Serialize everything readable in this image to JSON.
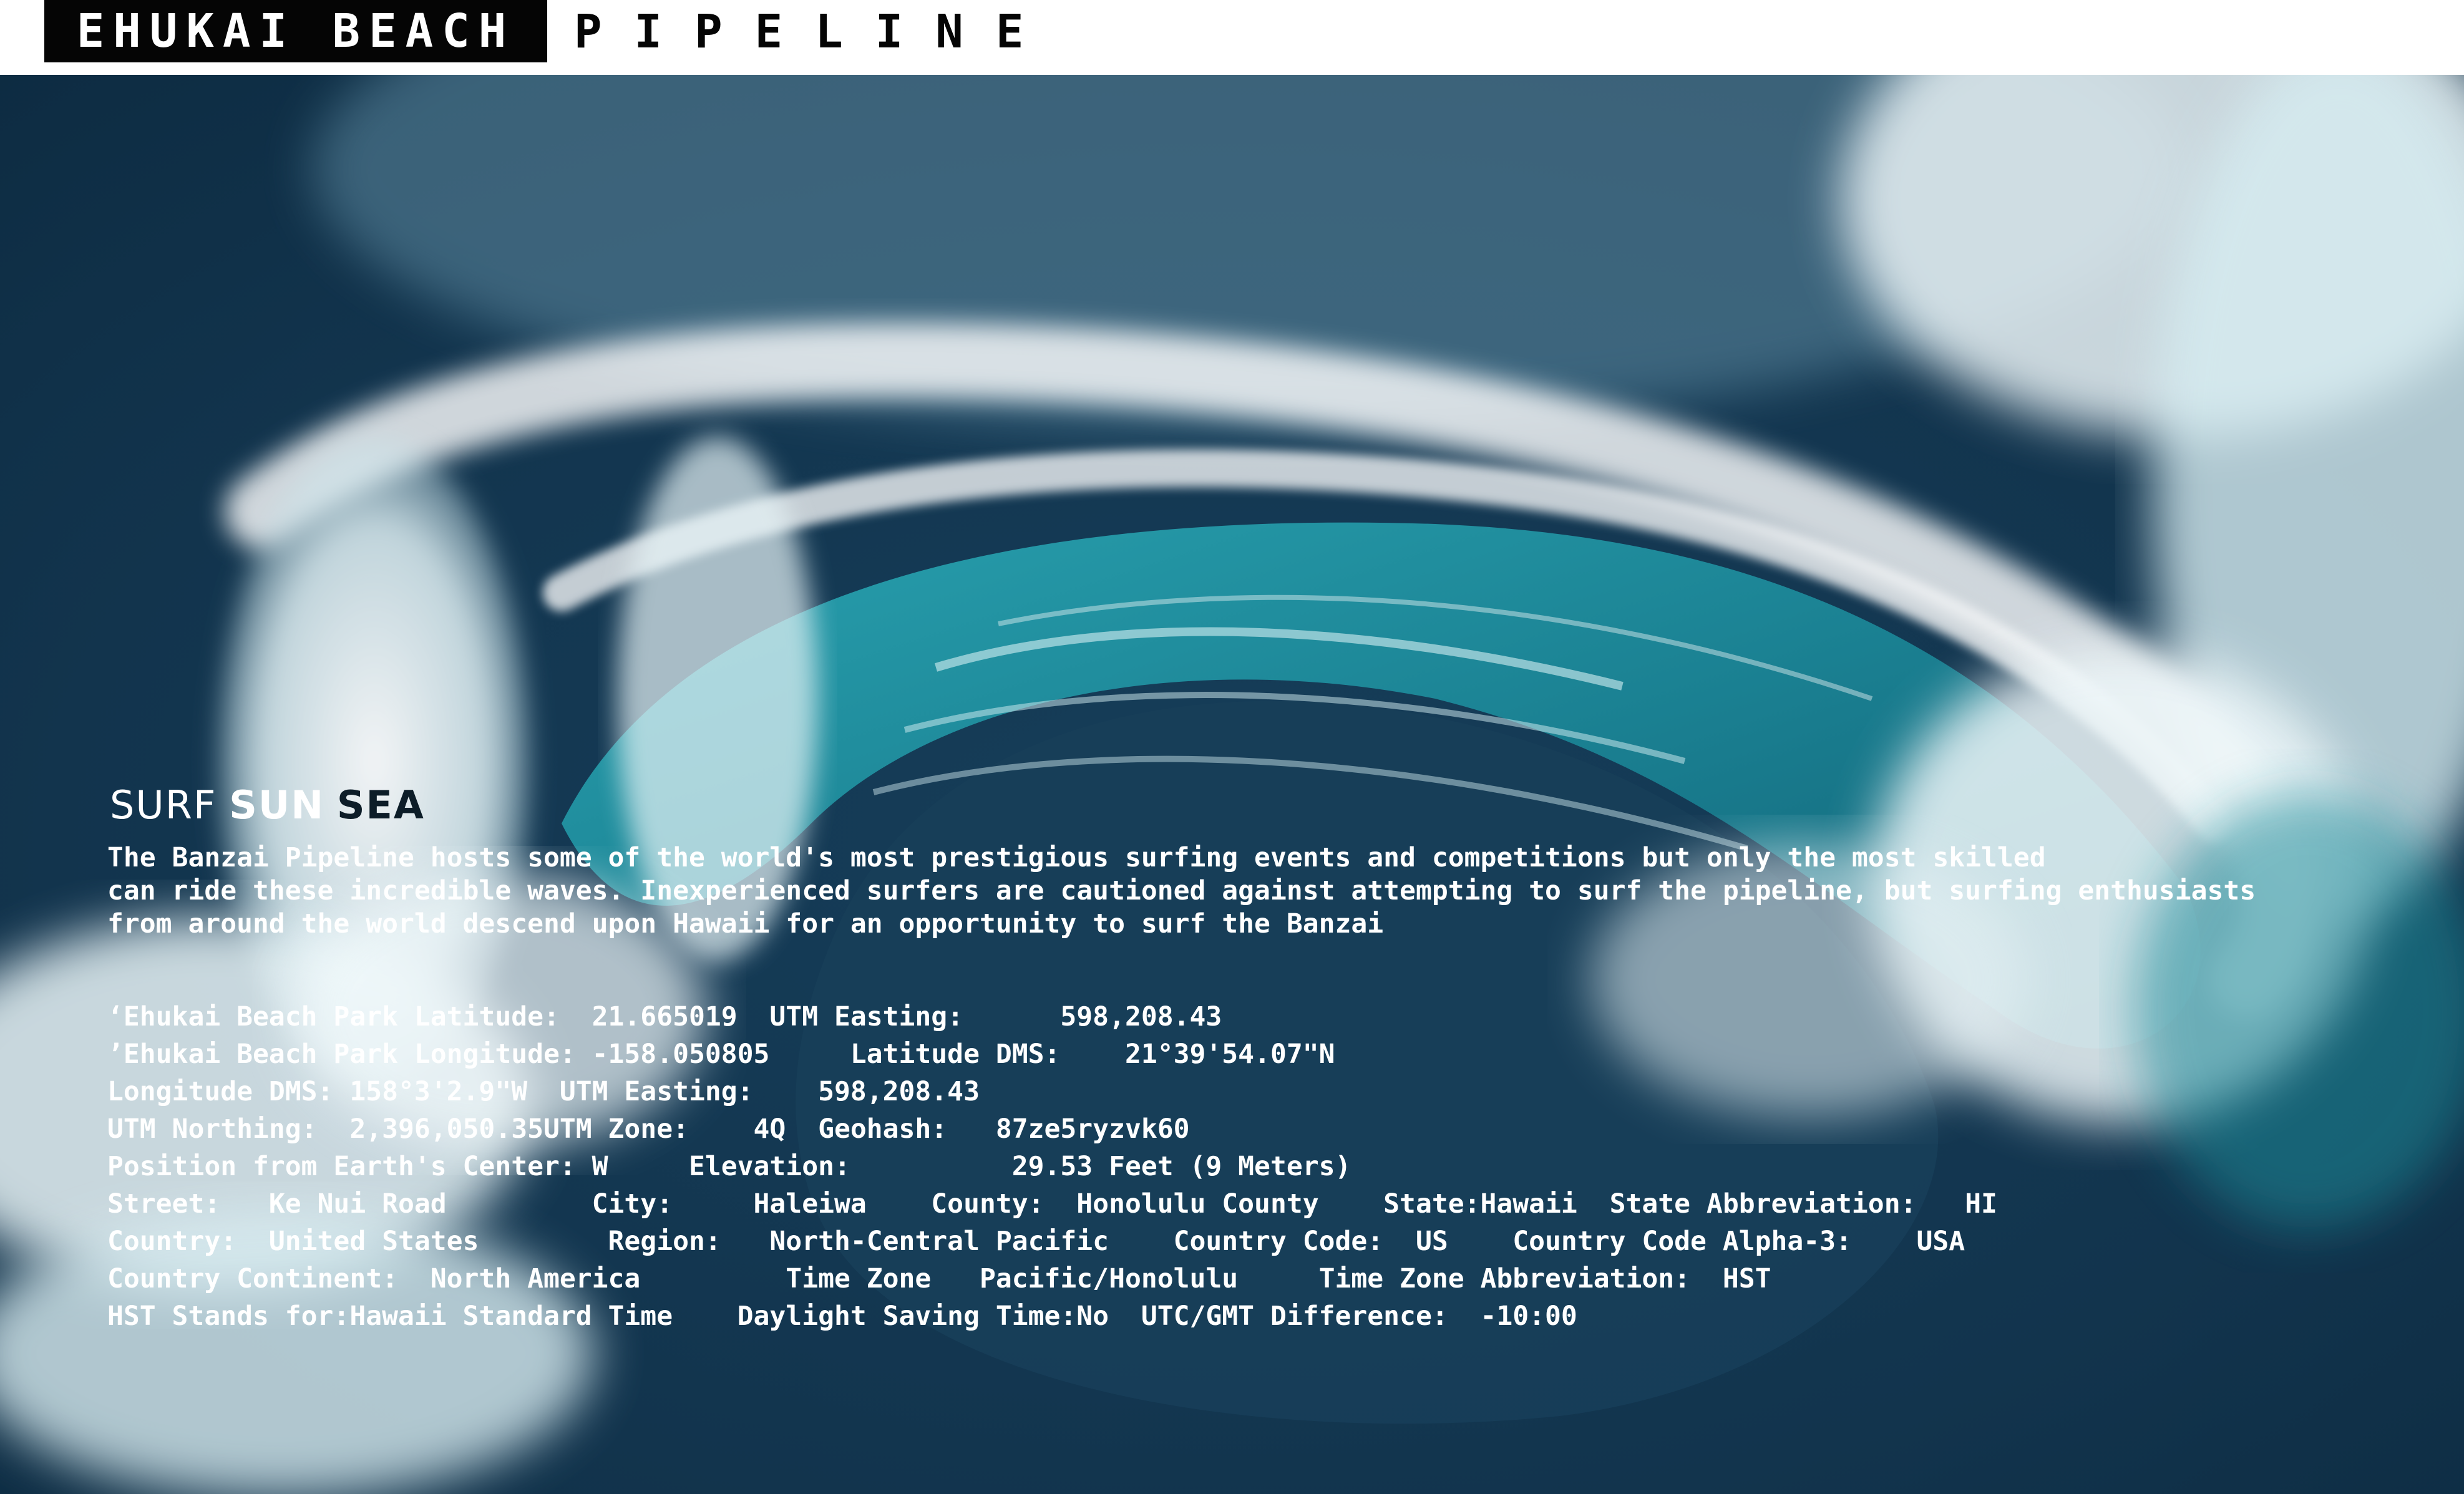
{
  "header": {
    "brand": "EHUKAI BEACH",
    "subtitle": "PIPELINE"
  },
  "photo": {
    "subject": "wave-photo",
    "colors": {
      "deep_sea": "#0f3550",
      "teal": "#1f8e9e",
      "foam": "#e6f3f6",
      "header_bg": "#050505"
    }
  },
  "tagline": {
    "part1": "SURF",
    "part2": "SUN",
    "part3": "SEA"
  },
  "description": {
    "lines": [
      "The Banzai Pipeline hosts some of the world's most prestigious surfing events and competitions but only the most skilled",
      "can ride these incredible waves. Inexperienced surfers are cautioned against attempting to surf the pipeline, but surfing enthusiasts",
      "from around the world descend upon Hawaii for an opportunity to surf the Banzai"
    ]
  },
  "facts": {
    "lines": [
      "‘Ehukai Beach Park Latitude:  21.665019  UTM Easting:      598,208.43",
      "’Ehukai Beach Park Longitude: -158.050805     Latitude DMS:    21°39'54.07\"N",
      "Longitude DMS: 158°3'2.9\"W  UTM Easting:    598,208.43",
      "UTM Northing:  2,396,050.35UTM Zone:    4Q  Geohash:   87ze5ryzvk60",
      "Position from Earth's Center: W     Elevation:          29.53 Feet (9 Meters)",
      "Street:   Ke Nui Road         City:     Haleiwa    County:  Honolulu County    State:Hawaii  State Abbreviation:   HI",
      "Country:  United States        Region:   North-Central Pacific    Country Code:  US    Country Code Alpha-3:    USA",
      "Country Continent:  North America         Time Zone   Pacific/Honolulu     Time Zone Abbreviation:  HST",
      "HST Stands for:Hawaii Standard Time    Daylight Saving Time:No  UTC/GMT Difference:  -10:00"
    ]
  }
}
